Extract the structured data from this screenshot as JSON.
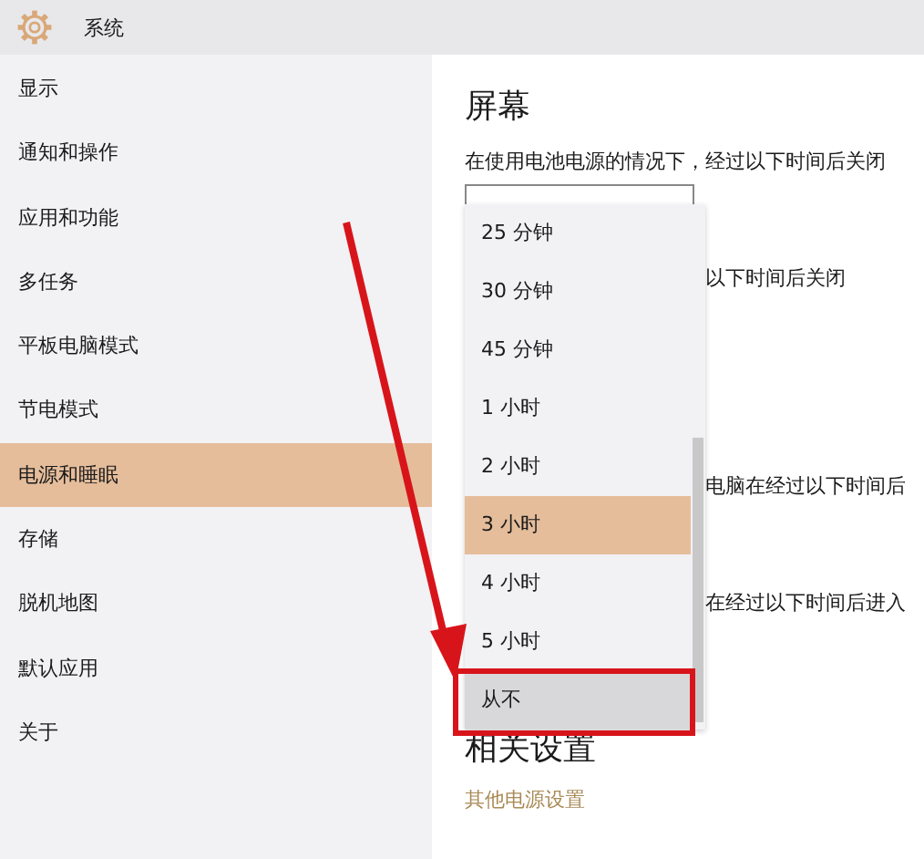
{
  "header": {
    "title": "系统"
  },
  "sidebar": {
    "items": [
      {
        "label": "显示",
        "selected": false
      },
      {
        "label": "通知和操作",
        "selected": false
      },
      {
        "label": "应用和功能",
        "selected": false
      },
      {
        "label": "多任务",
        "selected": false
      },
      {
        "label": "平板电脑模式",
        "selected": false
      },
      {
        "label": "节电模式",
        "selected": false
      },
      {
        "label": "电源和睡眠",
        "selected": true
      },
      {
        "label": "存储",
        "selected": false
      },
      {
        "label": "脱机地图",
        "selected": false
      },
      {
        "label": "默认应用",
        "selected": false
      },
      {
        "label": "关于",
        "selected": false
      }
    ]
  },
  "screen_section": {
    "title": "屏幕",
    "battery_label": "在使用电池电源的情况下，经过以下时间后关闭",
    "plugged_label_partial": "以下时间后关闭"
  },
  "sleep_section": {
    "texts_partial": [
      "电脑在经过以下时间后",
      "在经过以下时间后进入"
    ]
  },
  "dropdown_list": {
    "items": [
      {
        "label": "25 分钟",
        "selected": false,
        "hovered": false
      },
      {
        "label": "30 分钟",
        "selected": false,
        "hovered": false
      },
      {
        "label": "45 分钟",
        "selected": false,
        "hovered": false
      },
      {
        "label": "1 小时",
        "selected": false,
        "hovered": false
      },
      {
        "label": "2 小时",
        "selected": false,
        "hovered": false
      },
      {
        "label": "3 小时",
        "selected": true,
        "hovered": false
      },
      {
        "label": "4 小时",
        "selected": false,
        "hovered": false
      },
      {
        "label": "5 小时",
        "selected": false,
        "hovered": false
      },
      {
        "label": "从不",
        "selected": false,
        "hovered": true
      }
    ]
  },
  "related": {
    "title": "相关设置",
    "link": "其他电源设置"
  }
}
